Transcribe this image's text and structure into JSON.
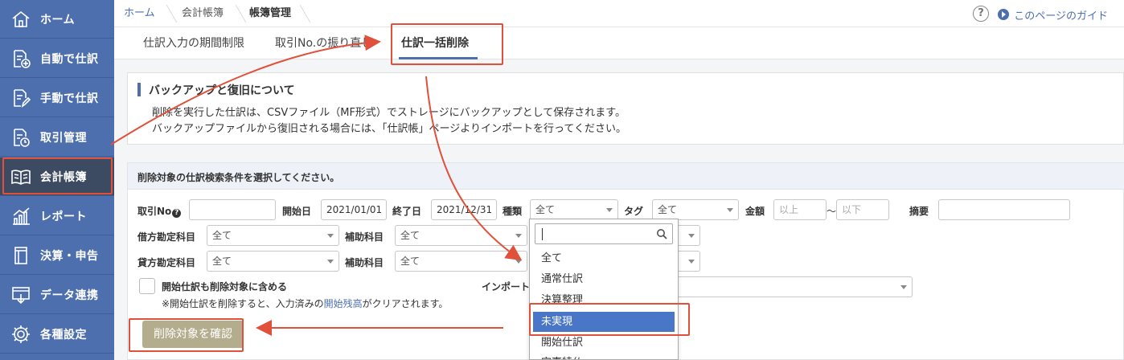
{
  "sidebar": {
    "items": [
      {
        "label": "ホーム",
        "icon": "home-icon"
      },
      {
        "label": "自動で仕訳",
        "icon": "auto-journal-icon"
      },
      {
        "label": "手動で仕訳",
        "icon": "manual-journal-icon"
      },
      {
        "label": "取引管理",
        "icon": "transaction-icon"
      },
      {
        "label": "会計帳簿",
        "icon": "book-icon"
      },
      {
        "label": "レポート",
        "icon": "report-icon"
      },
      {
        "label": "決算・申告",
        "icon": "settlement-icon"
      },
      {
        "label": "データ連携",
        "icon": "data-link-icon"
      },
      {
        "label": "各種設定",
        "icon": "gear-icon"
      }
    ],
    "active_index": 4
  },
  "breadcrumb": [
    "ホーム",
    "会計帳簿",
    "帳簿管理"
  ],
  "header": {
    "help": "?",
    "guide": "このページのガイド"
  },
  "tabs": [
    "仕訳入力の期間制限",
    "取引No.の振り直し",
    "仕訳一括削除"
  ],
  "info": {
    "title": "バックアップと復旧について",
    "line1": "削除を実行した仕訳は、CSVファイル（MF形式）でストレージにバックアップとして保存されます。",
    "line2": "バックアップファイルから復旧される場合には、「仕訳帳」ページよりインポートを行ってください。"
  },
  "panel": {
    "header": "削除対象の仕訳検索条件を選択してください。",
    "labels": {
      "no": "取引No",
      "start": "開始日",
      "end": "終了日",
      "type": "種類",
      "tag": "タグ",
      "amount": "金額",
      "tilde": "〜",
      "memo": "摘要",
      "debit": "借方勘定科目",
      "debit_sub": "補助科目",
      "credit": "貸方勘定科目",
      "credit_sub": "補助科目",
      "import": "インポート"
    },
    "values": {
      "start": "2021/01/01",
      "end": "2021/12/31",
      "type": "全て",
      "tag": "全て",
      "debit": "全て",
      "debit_sub": "全て",
      "credit": "全て",
      "credit_sub": "全て"
    },
    "placeholders": {
      "min": "以上",
      "max": "以下"
    },
    "checkbox_label": "開始仕訳も削除対象に含める",
    "note_prefix": "※開始仕訳を削除すると、入力済みの",
    "note_link": "開始残高",
    "note_suffix": "がクリアされます。",
    "confirm_button": "削除対象を確認"
  },
  "dropdown": {
    "options": [
      "全て",
      "通常仕訳",
      "決算整理",
      "未実現",
      "開始仕訳",
      "完事特仏"
    ],
    "selected_index": 3
  },
  "colors": {
    "sidebar": "#4d6fae",
    "sidebar_active": "#3c4a62",
    "accent": "#4d6fae",
    "annotation": "#e0503a",
    "confirm_button": "#b3ad8d",
    "dropdown_selected": "#4a76c7"
  }
}
